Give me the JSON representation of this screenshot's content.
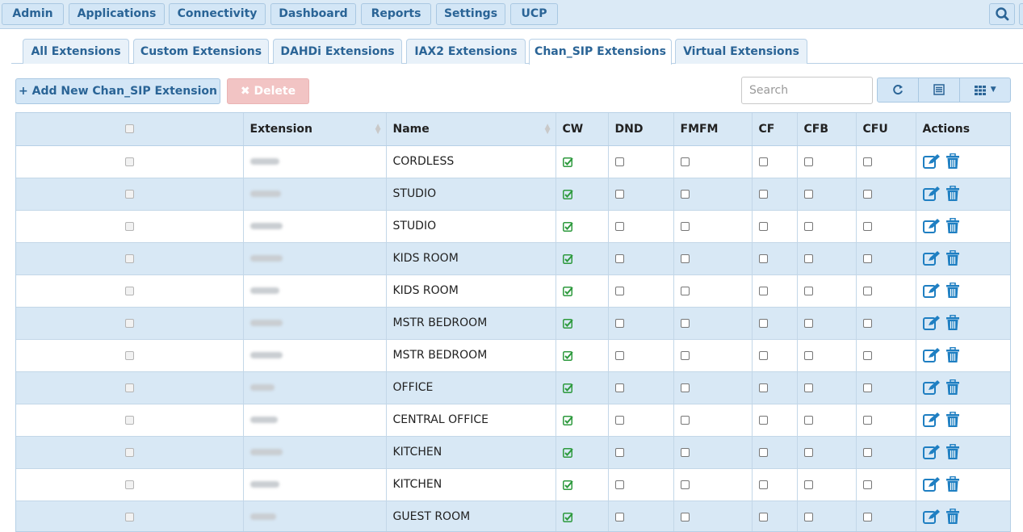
{
  "nav": {
    "items": [
      "Admin",
      "Applications",
      "Connectivity",
      "Dashboard",
      "Reports",
      "Settings",
      "UCP"
    ],
    "search_icon": "search-icon"
  },
  "tabs": [
    {
      "label": "All Extensions",
      "active": false
    },
    {
      "label": "Custom Extensions",
      "active": false
    },
    {
      "label": "DAHDi Extensions",
      "active": false
    },
    {
      "label": "IAX2 Extensions",
      "active": false
    },
    {
      "label": "Chan_SIP Extensions",
      "active": true
    },
    {
      "label": "Virtual Extensions",
      "active": false
    }
  ],
  "toolbar": {
    "add_label": "Add New Chan_SIP Extension",
    "delete_label": "Delete",
    "search_placeholder": "Search",
    "icons": [
      "refresh-icon",
      "list-icon",
      "columns-icon"
    ]
  },
  "table": {
    "columns": [
      "",
      "Extension",
      "Name",
      "CW",
      "DND",
      "FMFM",
      "CF",
      "CFB",
      "CFU",
      "Actions"
    ],
    "rows": [
      {
        "name": "CORDLESS",
        "cw": true,
        "dnd": false,
        "fmfm": false,
        "cf": false,
        "cfb": false,
        "cfu": false
      },
      {
        "name": "STUDIO",
        "cw": true,
        "dnd": false,
        "fmfm": false,
        "cf": false,
        "cfb": false,
        "cfu": false
      },
      {
        "name": "STUDIO",
        "cw": true,
        "dnd": false,
        "fmfm": false,
        "cf": false,
        "cfb": false,
        "cfu": false
      },
      {
        "name": "KIDS ROOM",
        "cw": true,
        "dnd": false,
        "fmfm": false,
        "cf": false,
        "cfb": false,
        "cfu": false
      },
      {
        "name": "KIDS ROOM",
        "cw": true,
        "dnd": false,
        "fmfm": false,
        "cf": false,
        "cfb": false,
        "cfu": false
      },
      {
        "name": "MSTR BEDROOM",
        "cw": true,
        "dnd": false,
        "fmfm": false,
        "cf": false,
        "cfb": false,
        "cfu": false
      },
      {
        "name": "MSTR BEDROOM",
        "cw": true,
        "dnd": false,
        "fmfm": false,
        "cf": false,
        "cfb": false,
        "cfu": false
      },
      {
        "name": "OFFICE",
        "cw": true,
        "dnd": false,
        "fmfm": false,
        "cf": false,
        "cfb": false,
        "cfu": false
      },
      {
        "name": "CENTRAL OFFICE",
        "cw": true,
        "dnd": false,
        "fmfm": false,
        "cf": false,
        "cfb": false,
        "cfu": false
      },
      {
        "name": "KITCHEN",
        "cw": true,
        "dnd": false,
        "fmfm": false,
        "cf": false,
        "cfb": false,
        "cfu": false
      },
      {
        "name": "KITCHEN",
        "cw": true,
        "dnd": false,
        "fmfm": false,
        "cf": false,
        "cfb": false,
        "cfu": false
      },
      {
        "name": "GUEST ROOM",
        "cw": true,
        "dnd": false,
        "fmfm": false,
        "cf": false,
        "cfb": false,
        "cfu": false
      }
    ]
  },
  "colors": {
    "accent": "#2a6496",
    "header_bg": "#d8e8f5",
    "check_green": "#2e9a3e",
    "action_blue": "#1f7fc2"
  }
}
